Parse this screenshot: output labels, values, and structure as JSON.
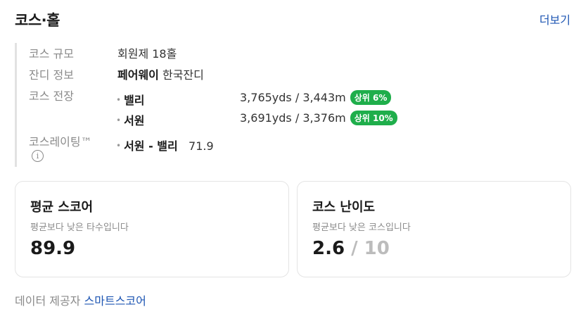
{
  "header": {
    "title": "코스·홀",
    "more_label": "더보기"
  },
  "course_info": {
    "size": {
      "label": "코스 규모",
      "value": "회원제 18홀"
    },
    "grass": {
      "label": "잔디 정보",
      "fairway": "페어웨이",
      "value": "한국잔디"
    },
    "length": {
      "label": "코스 전장",
      "courses": [
        {
          "name": "밸리",
          "yardage": "3,765yds / 3,443m",
          "rank": "상위 6%"
        },
        {
          "name": "서원",
          "yardage": "3,691yds / 3,376m",
          "rank": "상위 10%"
        }
      ]
    },
    "rating": {
      "label": "코스레이팅™",
      "info_icon": "i",
      "course": "서원 - 밸리",
      "value": "71.9"
    }
  },
  "cards": {
    "avg_score": {
      "title": "평균 스코어",
      "subtitle": "평균보다 낮은 타수입니다",
      "value": "89.9"
    },
    "difficulty": {
      "title": "코스 난이도",
      "subtitle": "평균보다 낮은 코스입니다",
      "value": "2.6",
      "max": "/ 10"
    }
  },
  "footer": {
    "prefix": "데이터 제공자",
    "provider": "스마트스코어"
  },
  "colors": {
    "accent": "#1e56b3",
    "badge": "#1fae4b"
  }
}
